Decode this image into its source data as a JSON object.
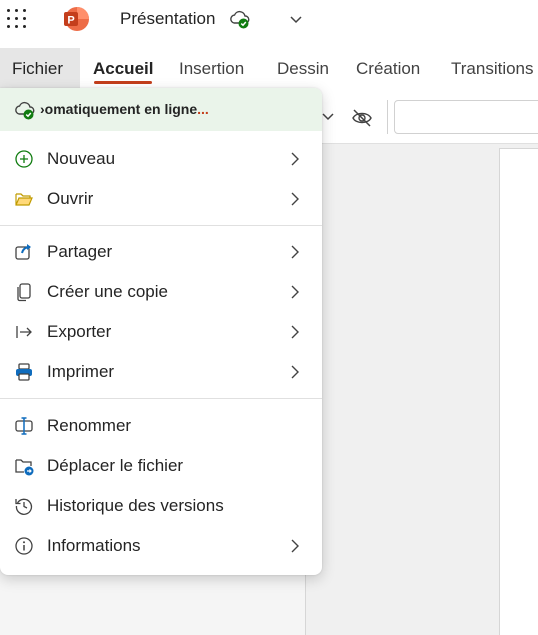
{
  "titlebar": {
    "app_icon": "powerpoint-logo",
    "app_letter": "P",
    "doc_title": "Présentation",
    "sync_icon": "cloud-check-icon"
  },
  "tabs": [
    {
      "label": "Fichier"
    },
    {
      "label": "Accueil"
    },
    {
      "label": "Insertion"
    },
    {
      "label": "Dessin"
    },
    {
      "label": "Création"
    },
    {
      "label": "Transitions"
    }
  ],
  "menu": {
    "status_text": "›omatiquement en ligne",
    "status_dots": "...",
    "items": [
      {
        "label": "Nouveau",
        "icon": "plus-circle-icon"
      },
      {
        "label": "Ouvrir",
        "icon": "folder-open-icon"
      },
      {
        "label": "Partager",
        "icon": "share-icon"
      },
      {
        "label": "Créer une copie",
        "icon": "copy-icon"
      },
      {
        "label": "Exporter",
        "icon": "export-icon"
      },
      {
        "label": "Imprimer",
        "icon": "printer-icon"
      },
      {
        "label": "Renommer",
        "icon": "rename-icon"
      },
      {
        "label": "Déplacer le fichier",
        "icon": "move-folder-icon"
      },
      {
        "label": "Historique des versions",
        "icon": "history-icon"
      },
      {
        "label": "Informations",
        "icon": "info-icon"
      }
    ]
  },
  "colors": {
    "accent": "#c43e1c",
    "sync_green": "#107c10",
    "status_bg": "#eaf4ea",
    "ppt_red": "#c43e1c"
  }
}
